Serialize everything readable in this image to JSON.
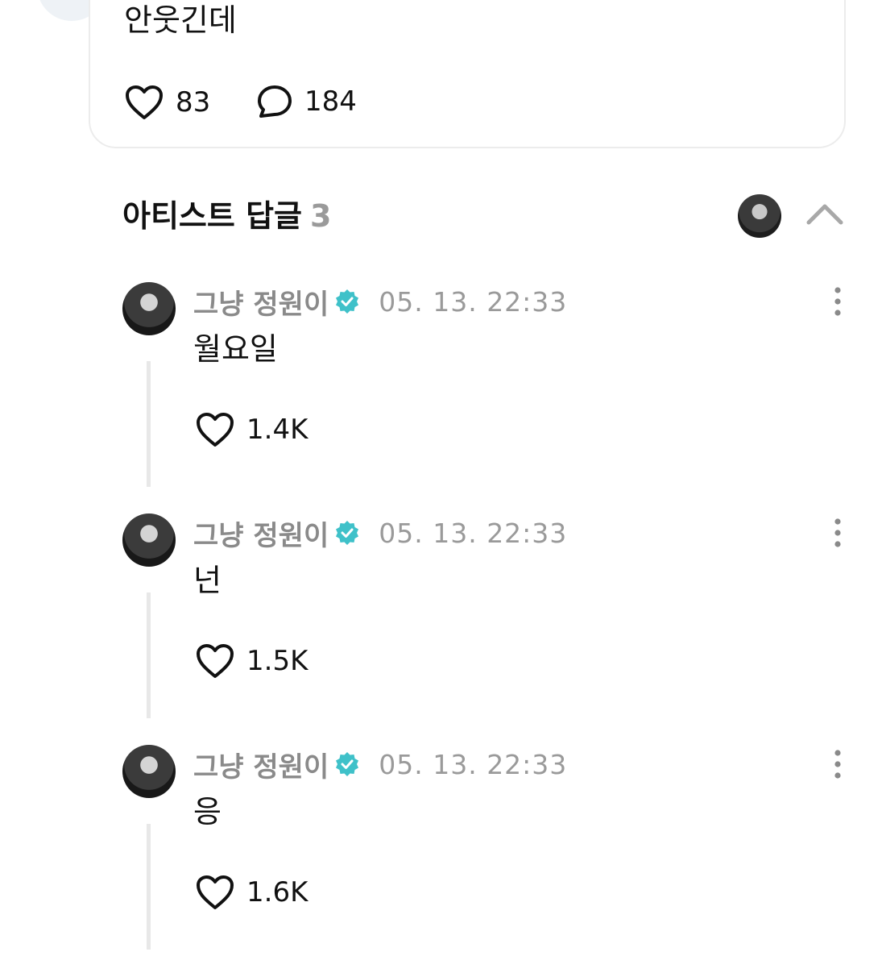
{
  "post": {
    "text": "안웃긴데",
    "likes": "83",
    "comments": "184"
  },
  "section": {
    "title": "아티스트 답글",
    "count": "3"
  },
  "replies": [
    {
      "author": "그냥 정원이",
      "time": "05. 13. 22:33",
      "text": "월요일",
      "likes": "1.4K"
    },
    {
      "author": "그냥 정원이",
      "time": "05. 13. 22:33",
      "text": "넌",
      "likes": "1.5K"
    },
    {
      "author": "그냥 정원이",
      "time": "05. 13. 22:33",
      "text": "응",
      "likes": "1.6K"
    }
  ],
  "colors": {
    "verified": "#3fc1c9",
    "muted_text": "#9a9a9a",
    "thread_line": "#e8e8e8"
  }
}
